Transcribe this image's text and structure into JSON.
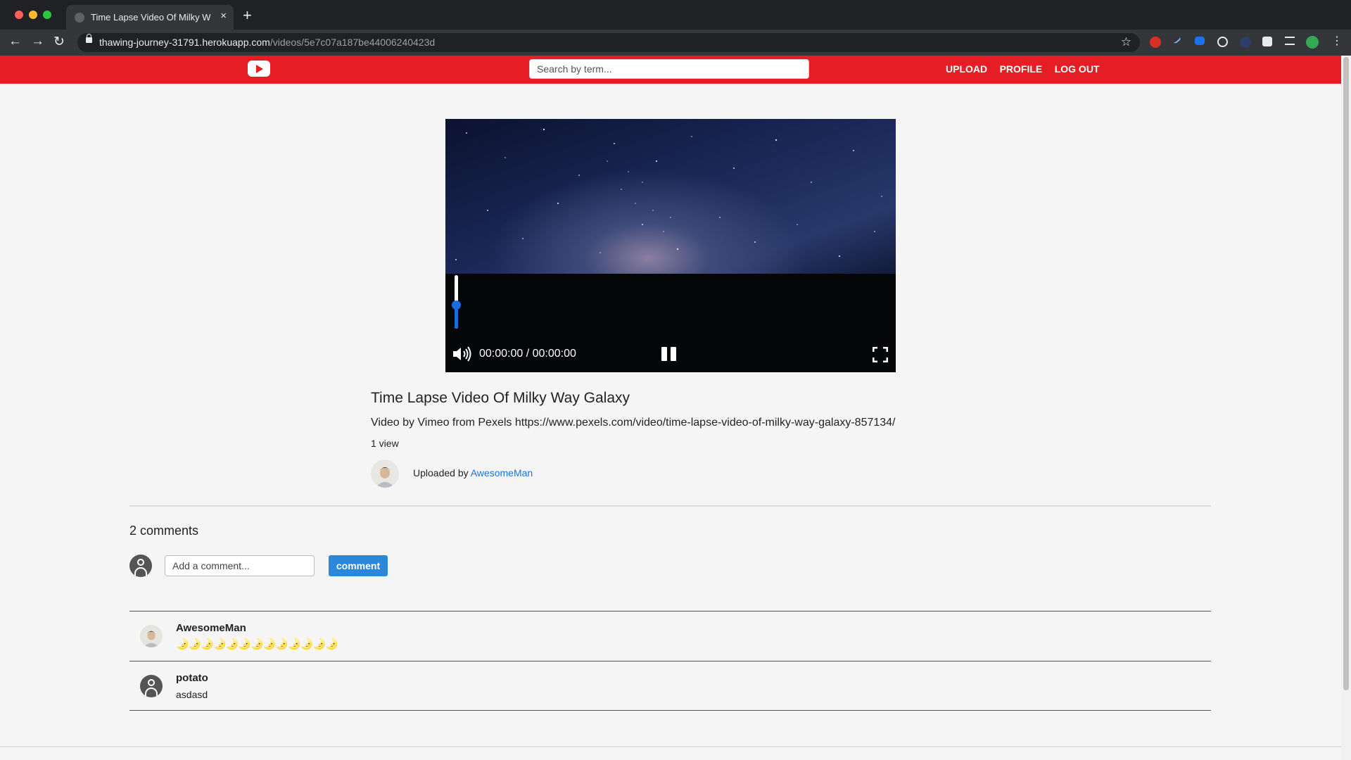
{
  "browser": {
    "tab_title": "Time Lapse Video Of Milky Way Galaxy",
    "tab_close": "×",
    "new_tab": "+",
    "url_host": "thawing-journey-31791.herokuapp.com",
    "url_path": "/videos/5e7c07a187be44006240423d",
    "back": "←",
    "forward": "→",
    "reload": "↻",
    "star": "☆"
  },
  "header": {
    "search_placeholder": "Search by term...",
    "nav": [
      "UPLOAD",
      "PROFILE",
      "LOG OUT"
    ]
  },
  "player": {
    "time": "00:00:00 / 00:00:00",
    "volume_level": 0.45
  },
  "video": {
    "title": "Time Lapse Video Of Milky Way Galaxy",
    "description": "Video by Vimeo from Pexels https://www.pexels.com/video/time-lapse-video-of-milky-way-galaxy-857134/",
    "views": "1 view",
    "uploaded_by_label": "Uploaded by",
    "uploader": "AwesomeMan"
  },
  "comments": {
    "count_label": "2 comments",
    "input_placeholder": "Add a comment...",
    "button_label": "comment",
    "items": [
      {
        "author": "AwesomeMan",
        "text": "🌛🌛🌛🌛🌛🌛🌛🌛🌛🌛🌛🌛🌛"
      },
      {
        "author": "potato",
        "text": "asdasd"
      }
    ]
  },
  "colors": {
    "header_red": "#e51e25",
    "accent_blue": "#2b87d9",
    "link_blue": "#1a73e8"
  }
}
